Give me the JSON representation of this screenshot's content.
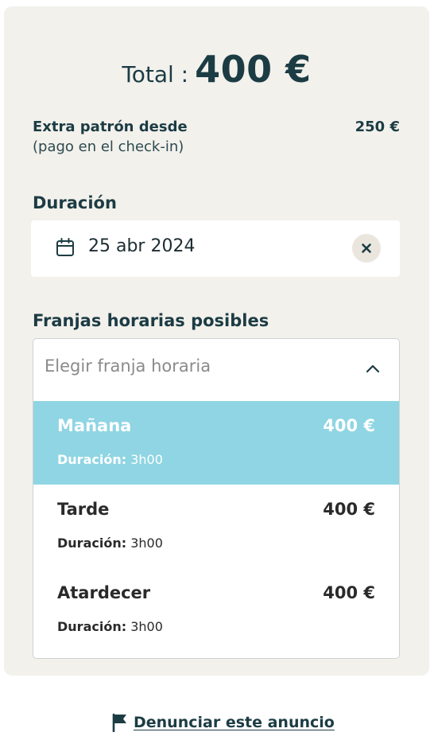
{
  "total": {
    "label": "Total :",
    "value": "400 €"
  },
  "extra": {
    "title": "Extra patrón desde",
    "price": "250 €",
    "note": "(pago en el check-in)"
  },
  "duration": {
    "label": "Duración",
    "date": "25 abr 2024",
    "icon": "calendar-icon",
    "clear_icon": "close-icon"
  },
  "slots": {
    "label": "Franjas horarias posibles",
    "placeholder": "Elegir franja horaria",
    "options": [
      {
        "name": "Mañana",
        "price": "400 €",
        "duration_label": "Duración:",
        "duration": "3h00",
        "selected": true
      },
      {
        "name": "Tarde",
        "price": "400 €",
        "duration_label": "Duración:",
        "duration": "3h00",
        "selected": false
      },
      {
        "name": "Atardecer",
        "price": "400 €",
        "duration_label": "Duración:",
        "duration": "3h00",
        "selected": false
      }
    ]
  },
  "report": {
    "label": "Denunciar este anuncio",
    "icon": "flag-icon"
  },
  "colors": {
    "card_bg": "#f3f1ec",
    "accent_selected": "#8fd5e3",
    "text_dark": "#1c3c44"
  }
}
